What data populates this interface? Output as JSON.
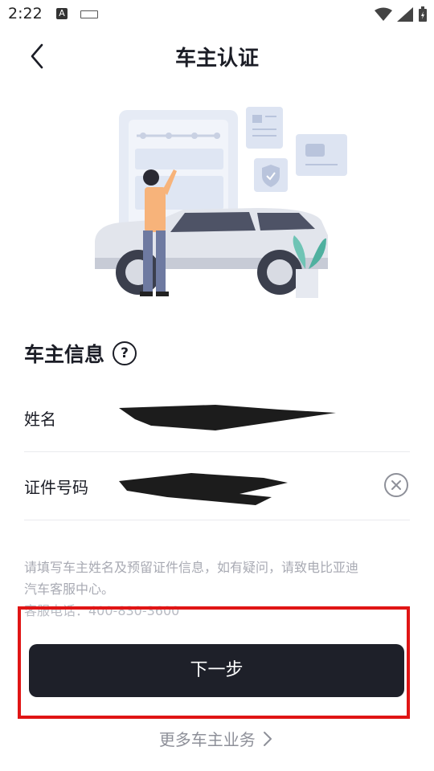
{
  "status_bar": {
    "time": "2:22",
    "a_label": "A"
  },
  "header": {
    "title": "车主认证"
  },
  "section": {
    "title": "车主信息",
    "help_glyph": "?"
  },
  "form": {
    "name_label": "姓名",
    "id_label": "证件号码"
  },
  "hint": {
    "line1": "请填写车主姓名及预留证件信息，如有疑问，请致电比亚迪",
    "line2": "汽车客服中心。",
    "phone": "客服电话：400-830-3600"
  },
  "buttons": {
    "next": "下一步"
  },
  "more": {
    "label": "更多车主业务"
  },
  "colors": {
    "accent_dark": "#1e2029",
    "highlight_red": "#e01515",
    "muted_text": "#a8aab3"
  }
}
